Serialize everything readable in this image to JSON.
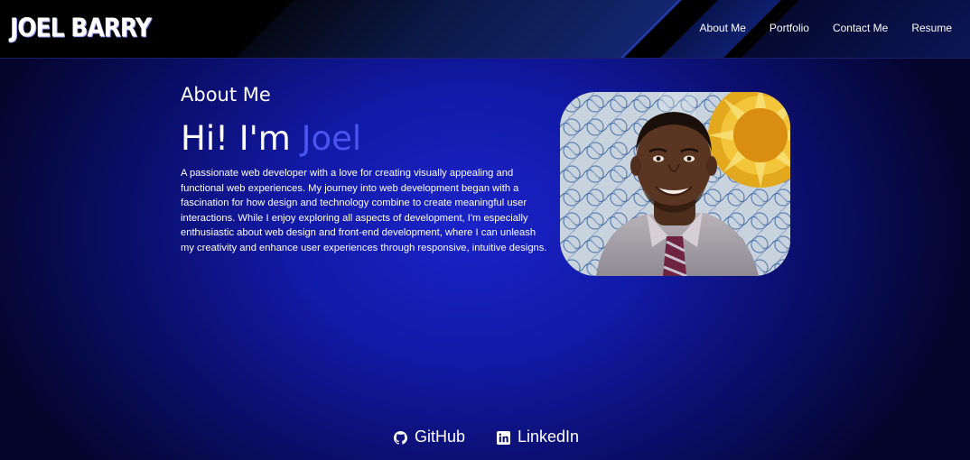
{
  "header": {
    "logo": "Joel Barry",
    "nav": [
      {
        "label": "About Me"
      },
      {
        "label": "Portfolio"
      },
      {
        "label": "Contact Me"
      },
      {
        "label": "Resume"
      }
    ]
  },
  "about": {
    "section_title": "About Me",
    "greeting_prefix": "Hi! I'm ",
    "greeting_name": "Joel",
    "bio": "A passionate web developer with a love for creating visually appealing and functional web experiences. My journey into web development began with a fascination for how design and technology combine to create meaningful user interactions. While I enjoy exploring all aspects of development, I'm especially enthusiastic about web design and front-end development, where I can unleash my creativity and enhance user experiences through responsive, intuitive designs."
  },
  "footer": {
    "links": [
      {
        "label": "GitHub",
        "icon": "github-icon"
      },
      {
        "label": "LinkedIn",
        "icon": "linkedin-icon"
      }
    ]
  },
  "colors": {
    "accent": "#4a55f0",
    "header_bg": "#000000",
    "page_bg": "#121aa8"
  }
}
